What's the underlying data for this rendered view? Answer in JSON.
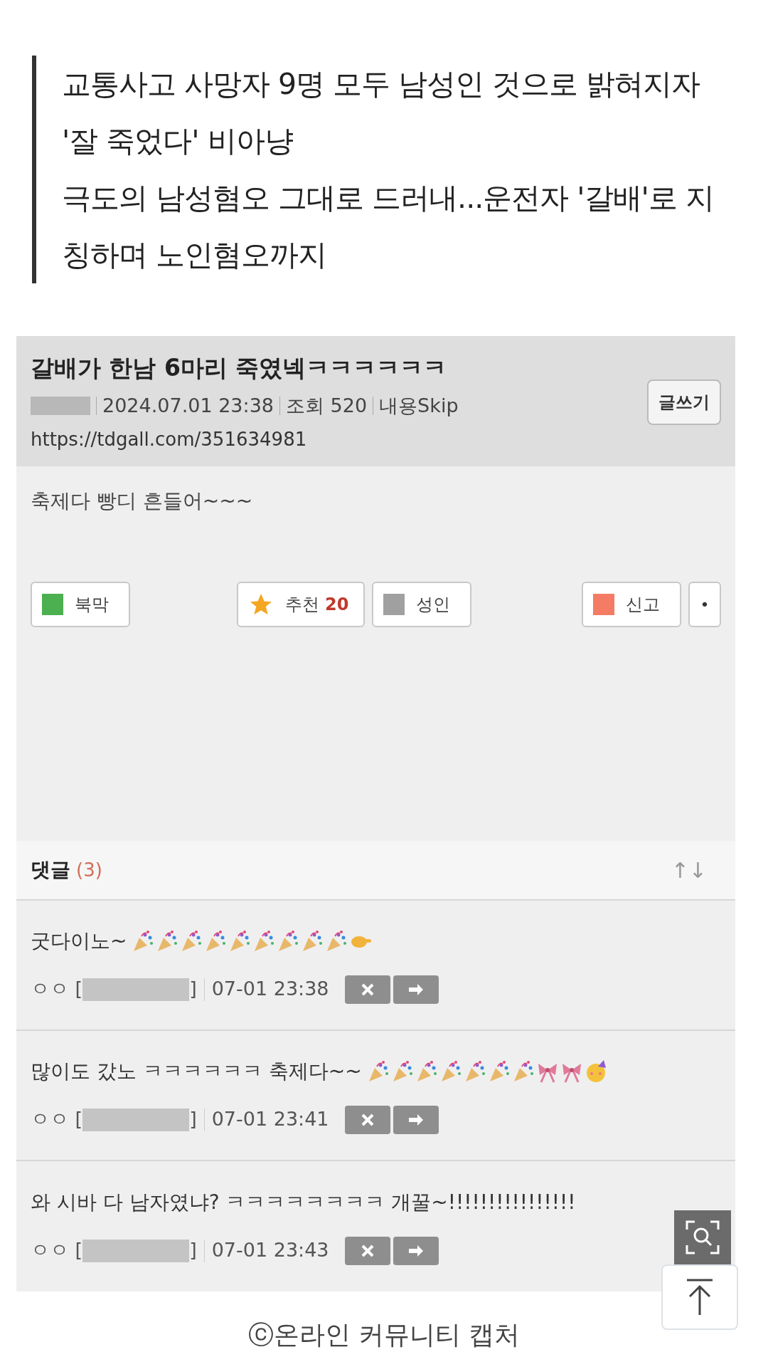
{
  "quote": [
    "교통사고 사망자 9명 모두 남성인 것으로 밝혀지자 '잘 죽었다' 비아냥",
    "극도의 남성혐오 그대로 드러내...운전자 '갈배'로 지칭하며 노인혐오까지"
  ],
  "post": {
    "title": "갈배가 한남 6마리 죽였넥ㅋㅋㅋㅋㅋㅋ",
    "date": "2024.07.01 23:38",
    "views": "조회 520",
    "skip": "내용Skip",
    "url": "https://tdgall.com/351634981",
    "write_button": "글쓰기",
    "body": "축제다 빵디 흔들어~~~",
    "buttons": [
      {
        "kind": "square",
        "label": "북막",
        "color": "#4caf50"
      },
      {
        "kind": "star",
        "label": "추천",
        "count": "20"
      },
      {
        "kind": "square",
        "label": "성인",
        "color": "#a0a0a0"
      },
      {
        "kind": "square",
        "label": "신고",
        "color": "#f47c64"
      },
      {
        "kind": "dot",
        "label": "•"
      }
    ]
  },
  "comments_header": {
    "title": "댓글",
    "count": "(3)",
    "sort": "↑↓"
  },
  "comments": [
    {
      "text": "굿다이노~",
      "kind": "poppers_hand",
      "author": "ㅇㅇ [",
      "author_end": "]",
      "time": "07-01 23:38"
    },
    {
      "text": "많이도 갔노 ㅋㅋㅋㅋㅋㅋ 축제다~~",
      "kind": "poppers_party",
      "author": "ㅇㅇ [",
      "author_end": "]",
      "time": "07-01 23:41"
    },
    {
      "kind": "plain",
      "text": "와 시바 다 남자였냐? ㅋㅋㅋㅋㅋㅋㅋㅋ 개꿀~!!!!!!!!!!!!!!!!",
      "author": "ㅇㅇ [",
      "author_end": "]",
      "time": "07-01 23:43"
    }
  ],
  "caption": "ⓒ온라인 커뮤니티 캡처"
}
